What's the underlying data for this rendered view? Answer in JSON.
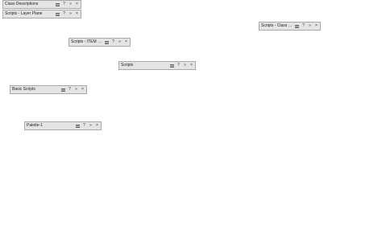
{
  "palettes": [
    {
      "id": "class-descriptions",
      "title": "Class Descriptions"
    },
    {
      "id": "scripts-layer-plane",
      "title": "Scripts - Layer Plane"
    },
    {
      "id": "scripts-class-ed",
      "title": "Scripts - Class Ed..."
    },
    {
      "id": "scripts-item-re",
      "title": "Scripts - ITEM Re..."
    },
    {
      "id": "scripts",
      "title": "Scripts"
    },
    {
      "id": "basic-scripts",
      "title": "Basic Scripts"
    },
    {
      "id": "palette-1",
      "title": "Palette-1"
    }
  ],
  "controls": {
    "menu_icon": "hamburger-menu-icon",
    "help_label": "?",
    "collapse_label": "»",
    "close_label": "×"
  }
}
